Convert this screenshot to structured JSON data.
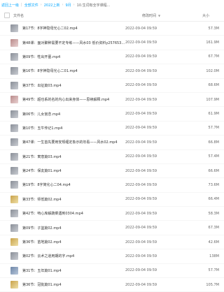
{
  "breadcrumb": {
    "back": "返回上一级",
    "all_files": "全部文件",
    "path": [
      "2022上新",
      "9月",
      "10.生词有全字课程..."
    ]
  },
  "header": {
    "name_label": "文件名",
    "time_label": "修改时间",
    "size_label": "大小"
  },
  "files": [
    {
      "name": "第17节：8字神隐母光心二02.mp4",
      "time": "2022-09-04 09:59",
      "size": "57.3M",
      "thumb": "gray"
    },
    {
      "name": "第48课：面对聚种需要不定专练——风水03 低价资料y257653117...",
      "time": "2022-09-04 09:59",
      "size": "161.9M",
      "thumb": "pink"
    },
    {
      "name": "第09节：牲出开墓.mp4",
      "time": "2022-09-04 09:59",
      "size": "67.7M",
      "thumb": "gray"
    },
    {
      "name": "第16节：8字神隐母光心二01.mp4",
      "time": "2022-09-04 09:59",
      "size": "102.0M",
      "thumb": "gray"
    },
    {
      "name": "第37节：出征篇03.mp4",
      "time": "2022-09-04 09:59",
      "size": "68.6M",
      "thumb": "gray"
    },
    {
      "name": "第49节：超也系的名的内心出来身体——思续解释.mp4",
      "time": "2022-09-04 09:59",
      "size": "107.9M",
      "thumb": "pink"
    },
    {
      "name": "第06节：儿女宫念.mp4",
      "time": "2022-09-04 09:59",
      "size": "61.9M",
      "thumb": "gray"
    },
    {
      "name": "第10节：五牛传记1.mp4",
      "time": "2022-09-04 09:59",
      "size": "57.7M",
      "thumb": "gray"
    },
    {
      "name": "第47课：一生首先要用安规缠定象示的年看——风水02.mp4",
      "time": "2022-09-04 09:59",
      "size": "66.8M",
      "thumb": "gray"
    },
    {
      "name": "第21节：寓意篇03.mp4",
      "time": "2022-09-04 09:59",
      "size": "57.4M",
      "thumb": "gray"
    },
    {
      "name": "第24节：保友篇01.mp4",
      "time": "2022-09-04 09:59",
      "size": "66.6M",
      "thumb": "gray"
    },
    {
      "name": "第19节：8字简化心二04.mp4",
      "time": "2022-09-04 09:59",
      "size": "73.6M",
      "thumb": "gray"
    },
    {
      "name": "第33节：师低篇02.mp4",
      "time": "2022-09-04 09:59",
      "size": "66.4M",
      "thumb": "gold"
    },
    {
      "name": "第42节：啃心库解蔬菜遇到0304.mp4",
      "time": "2022-09-04 09:59",
      "size": "58.3M",
      "thumb": "gray"
    },
    {
      "name": "第09节：子篮篇02.mp4",
      "time": "2022-09-04 09:59",
      "size": "67.3M",
      "thumb": "gray"
    },
    {
      "name": "第36节：苗地篇02.mp4",
      "time": "2022-09-04 09:59",
      "size": "42.6M",
      "thumb": "gold"
    },
    {
      "name": "第02节：云术之道用期的字.mp4",
      "time": "2022-09-04 09:59",
      "size": "138M",
      "thumb": "gray"
    },
    {
      "name": "第31节：五年篇01.mp4",
      "time": "2022-09-04 09:59",
      "size": "57.7M",
      "thumb": "blue"
    },
    {
      "name": "第36节：冠批篇01.mp4",
      "time": "2022-09-04 09:59",
      "size": "105.7M",
      "thumb": "gold"
    }
  ]
}
